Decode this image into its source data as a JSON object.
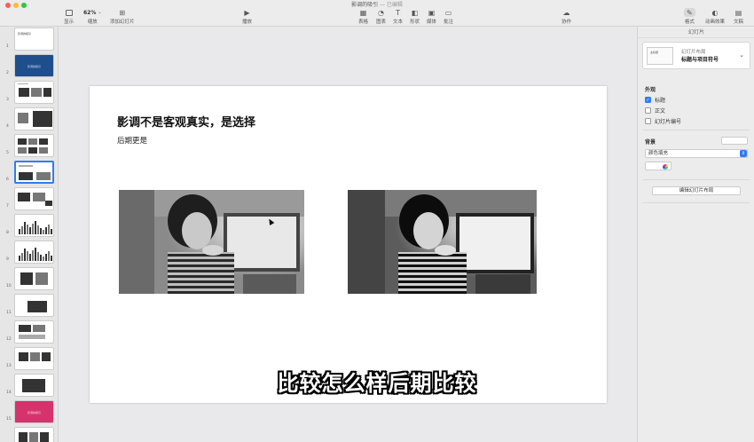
{
  "window": {
    "title": "影调的吸引",
    "subtitle": "— 已编辑"
  },
  "toolbar": {
    "view_label": "显示",
    "zoom_value": "62%",
    "zoom_label": "缩放",
    "add_slide_label": "添加幻灯片",
    "play_label": "播放",
    "table_label": "表格",
    "chart_label": "图表",
    "text_label": "文本",
    "shape_label": "形状",
    "media_label": "媒体",
    "comment_label": "批注",
    "collaborate_label": "协作",
    "format_label": "格式",
    "animate_label": "动画效果",
    "document_label": "文稿"
  },
  "navigator": {
    "slides": [
      {
        "num": "1",
        "type": "title",
        "text": "影调的吸引"
      },
      {
        "num": "2",
        "type": "blue",
        "text": "影调的吸引"
      },
      {
        "num": "3",
        "type": "photos-a"
      },
      {
        "num": "4",
        "type": "photos-b"
      },
      {
        "num": "5",
        "type": "photos-c"
      },
      {
        "num": "6",
        "type": "current"
      },
      {
        "num": "7",
        "type": "photos-d"
      },
      {
        "num": "8",
        "type": "histogram"
      },
      {
        "num": "9",
        "type": "histogram-b"
      },
      {
        "num": "10",
        "type": "photos-e"
      },
      {
        "num": "11",
        "type": "dark-block"
      },
      {
        "num": "12",
        "type": "photos-f"
      },
      {
        "num": "13",
        "type": "photos-g"
      },
      {
        "num": "14",
        "type": "dark-block-b"
      },
      {
        "num": "15",
        "type": "pink",
        "text": "影调的吸引"
      },
      {
        "num": "16",
        "type": "photos-h"
      }
    ]
  },
  "slide": {
    "title": "影调不是客观真实，是选择",
    "body": "后期更是"
  },
  "caption": "比较怎么样后期比较",
  "inspector": {
    "header": "幻灯片",
    "layout_label": "幻灯片布局",
    "layout_name": "标题与项目符号",
    "layout_thumb_text": "主标题",
    "appearance_title": "外观",
    "options": [
      {
        "label": "标题",
        "checked": true
      },
      {
        "label": "正文",
        "checked": false
      },
      {
        "label": "幻灯片编号",
        "checked": false
      }
    ],
    "background_label": "背景",
    "fill_value": "颜色填充",
    "edit_layout_button": "编辑幻灯片布局"
  },
  "colors": {
    "accent": "#2f7cf6",
    "slide_bg": "#ffffff",
    "thumb_blue": "#1f4e8c",
    "thumb_pink": "#d6336c"
  }
}
